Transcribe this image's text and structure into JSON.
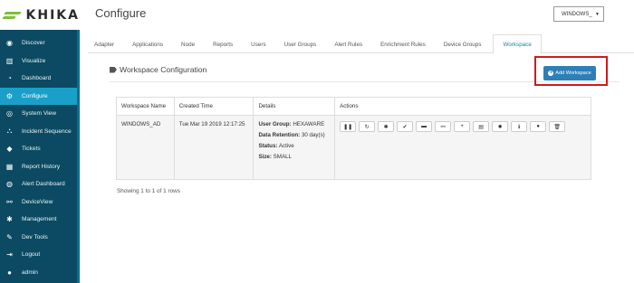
{
  "brand": {
    "name": "KHIKA"
  },
  "sidebar": {
    "items": [
      {
        "label": "Discover",
        "icon": "compass-icon",
        "active": false
      },
      {
        "label": "Visualize",
        "icon": "bar-chart-icon",
        "active": false
      },
      {
        "label": "Dashboard",
        "icon": "gauge-icon",
        "active": false
      },
      {
        "label": "Configure",
        "icon": "wrench-icon",
        "active": true
      },
      {
        "label": "System View",
        "icon": "eye-icon",
        "active": false
      },
      {
        "label": "Incident Sequence",
        "icon": "sequence-icon",
        "active": false
      },
      {
        "label": "Tickets",
        "icon": "tag-icon",
        "active": false
      },
      {
        "label": "Report History",
        "icon": "report-icon",
        "active": false
      },
      {
        "label": "Alert Dashboard",
        "icon": "globe-icon",
        "active": false
      },
      {
        "label": "DeviceView",
        "icon": "sitemap-icon",
        "active": false
      },
      {
        "label": "Management",
        "icon": "gear-icon",
        "active": false
      },
      {
        "label": "Dev Tools",
        "icon": "wrench-tool-icon",
        "active": false
      },
      {
        "label": "Logout",
        "icon": "logout-icon",
        "active": false
      },
      {
        "label": "admin",
        "icon": "user-icon",
        "active": false
      }
    ]
  },
  "header": {
    "title": "Configure",
    "env_select": {
      "value": "WINDOWS_"
    }
  },
  "tabs": [
    {
      "label": "Adapter",
      "active": false
    },
    {
      "label": "Applications",
      "active": false
    },
    {
      "label": "Node",
      "active": false
    },
    {
      "label": "Reports",
      "active": false
    },
    {
      "label": "Users",
      "active": false
    },
    {
      "label": "User Groups",
      "active": false
    },
    {
      "label": "Alert Rules",
      "active": false
    },
    {
      "label": "Enrichment Rules",
      "active": false
    },
    {
      "label": "Device Groups",
      "active": false
    },
    {
      "label": "Workspace",
      "active": true
    }
  ],
  "workspace": {
    "section_title": "Workspace Configuration",
    "add_button_label": "Add Workspace",
    "table": {
      "headers": [
        "Workspace Name",
        "Created Time",
        "Details",
        "Actions"
      ],
      "rows": [
        {
          "name": "WINDOWS_AD",
          "created": "Tue Mar 19 2019 12:17:25",
          "details": {
            "user_group_label": "User Group:",
            "user_group_value": "HEXAWARE",
            "retention_label": "Data Retention:",
            "retention_value": "30 day(s)",
            "status_label": "Status:",
            "status_value": "Active",
            "size_label": "Size:",
            "size_value": "SMALL"
          }
        }
      ]
    },
    "actions": [
      {
        "name": "pause-icon",
        "glyph": "❚❚"
      },
      {
        "name": "refresh-icon",
        "glyph": "↻"
      },
      {
        "name": "gear-icon",
        "glyph": "✱"
      },
      {
        "name": "check-icon",
        "glyph": "✔"
      },
      {
        "name": "archive-icon",
        "glyph": "▬"
      },
      {
        "name": "sitemap-icon",
        "glyph": "⚯"
      },
      {
        "name": "plus-icon",
        "glyph": "+"
      },
      {
        "name": "file-icon",
        "glyph": "▤"
      },
      {
        "name": "bug-icon",
        "glyph": "✹"
      },
      {
        "name": "info-icon",
        "glyph": "ℹ"
      },
      {
        "name": "user-icon",
        "glyph": "●"
      },
      {
        "name": "trash-icon",
        "glyph": "🗑"
      }
    ],
    "footer": "Showing 1 to 1 of 1 rows"
  },
  "colors": {
    "sidebar_bg": "#0b4a62",
    "active_nav": "#1aa0c8",
    "primary_button": "#2e7fb8",
    "highlight_border": "#d11a1a"
  }
}
